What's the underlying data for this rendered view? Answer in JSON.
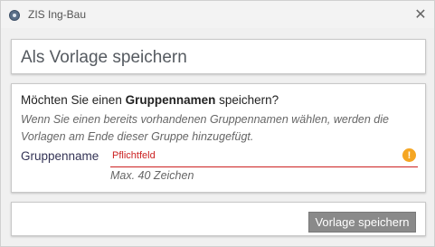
{
  "window": {
    "title": "ZIS Ing-Bau",
    "close_glyph": "✕"
  },
  "header": {
    "title": "Als Vorlage speichern"
  },
  "form": {
    "question_before": "Möchten Sie einen ",
    "question_bold": "Gruppennamen",
    "question_after": " speichern?",
    "hint": "Wenn Sie einen bereits vorhandenen Gruppennamen wählen, werden die Vorlagen am Ende dieser Gruppe hinzugefügt.",
    "field_label": "Gruppenname",
    "field_value": "",
    "field_placeholder": "Pflichtfeld",
    "field_status_glyph": "!",
    "field_helper": "Max. 40 Zeichen"
  },
  "footer": {
    "save_label": "Vorlage speichern"
  },
  "colors": {
    "error": "#cc2222",
    "warning": "#f5a623",
    "button_bg": "#8a8a8a"
  },
  "icons": {
    "app": "app-icon",
    "close": "close-icon",
    "warning": "warning-icon"
  }
}
